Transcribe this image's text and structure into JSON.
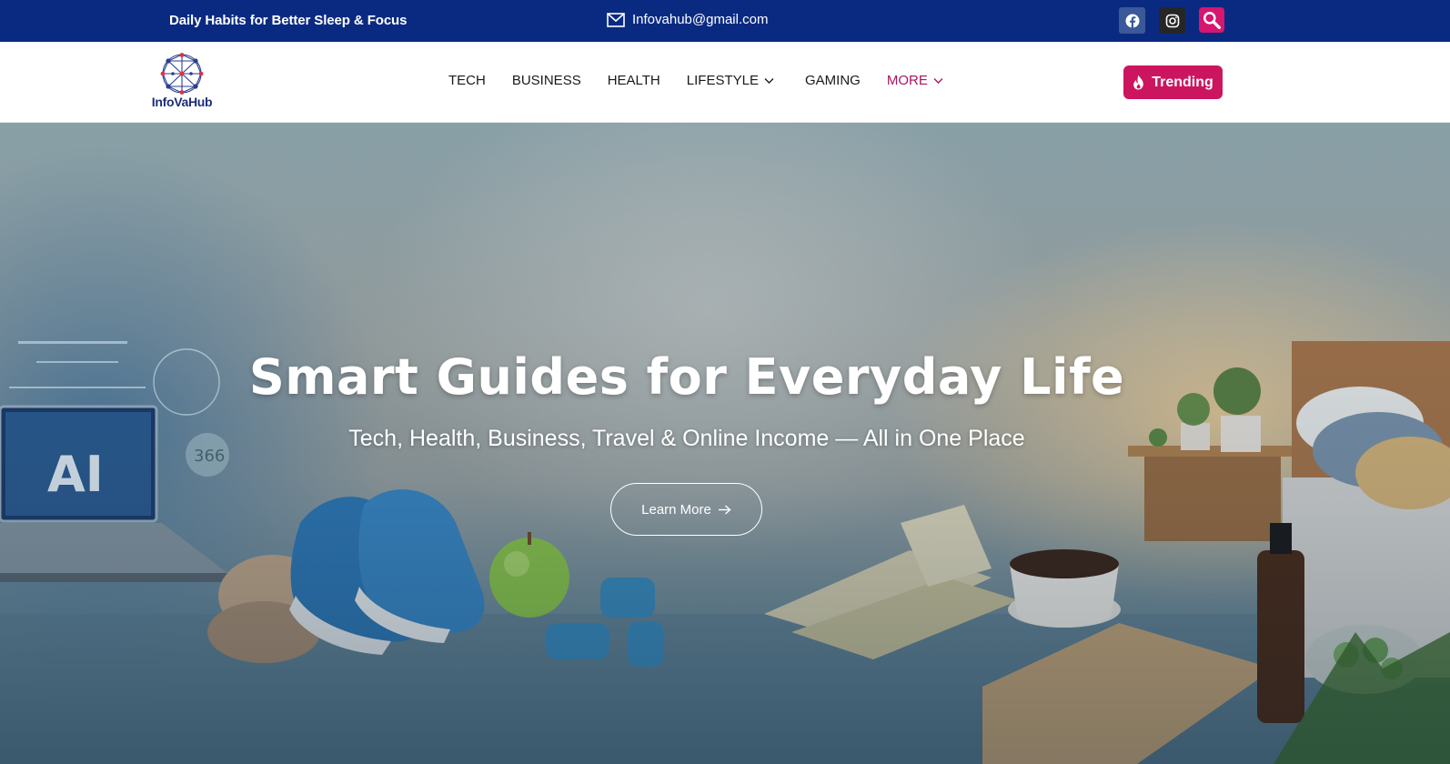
{
  "topbar": {
    "tagline": "Daily Habits for Better Sleep & Focus",
    "email": "Infovahub@gmail.com",
    "social": [
      {
        "name": "facebook-icon",
        "color": "#3b5998"
      },
      {
        "name": "instagram-icon",
        "color": "#262626"
      },
      {
        "name": "search-icon",
        "color": "#d6166f"
      }
    ],
    "background": "#0a2a82"
  },
  "header": {
    "logo_text": "InfoVaHub",
    "nav": [
      {
        "label": "TECH",
        "has_dropdown": false
      },
      {
        "label": "BUSINESS",
        "has_dropdown": false
      },
      {
        "label": "HEALTH",
        "has_dropdown": false
      },
      {
        "label": "LIFESTYLE",
        "has_dropdown": true
      },
      {
        "label": "GAMING",
        "has_dropdown": false
      },
      {
        "label": "MORE",
        "has_dropdown": true,
        "highlighted": true
      }
    ],
    "trending_label": "Trending",
    "trending_icon": "flame-icon",
    "accent_color": "#cc155f"
  },
  "hero": {
    "title": "Smart Guides for Everyday Life",
    "subtitle": "Tech, Health, Business, Travel & Online Income — All in One Place",
    "cta_label": "Learn More",
    "cta_icon": "arrow-right-icon",
    "scene_labels": {
      "laptop_text": "AI",
      "badge_text": "366"
    }
  }
}
